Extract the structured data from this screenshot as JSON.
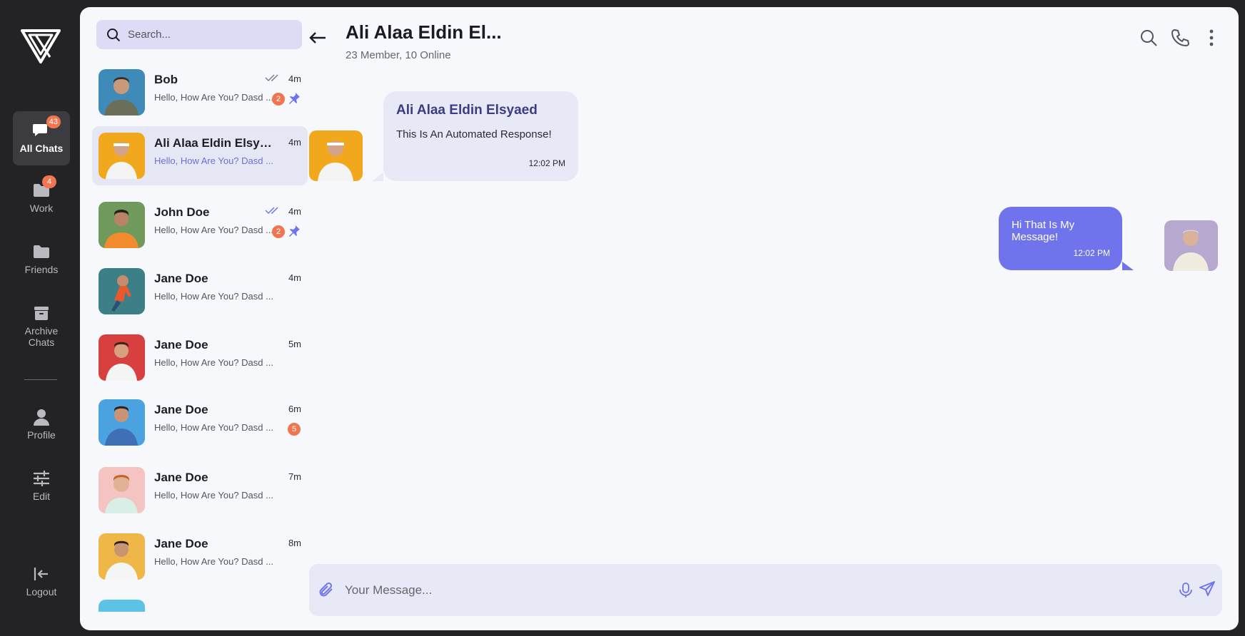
{
  "colors": {
    "accent": "#7074ec",
    "badge": "#f0764f",
    "rail_bg": "#232326",
    "panel_bg": "#f7f8fb"
  },
  "nav": {
    "items": [
      {
        "label": "All Chats",
        "icon": "chat-bubbles-icon",
        "badge": "43",
        "active": true
      },
      {
        "label": "Work",
        "icon": "folder-icon",
        "badge": "4"
      },
      {
        "label": "Friends",
        "icon": "folder-icon"
      },
      {
        "label": "Archive Chats",
        "icon": "archive-icon"
      },
      {
        "label": "Profile",
        "icon": "user-icon"
      },
      {
        "label": "Edit",
        "icon": "sliders-icon"
      },
      {
        "label": "Logout",
        "icon": "logout-icon"
      }
    ]
  },
  "search": {
    "placeholder": "Search..."
  },
  "chats": [
    {
      "name": "Bob",
      "time": "4m",
      "preview": "Hello, How Are You? Dasd ...",
      "unread": "2",
      "pinned": true,
      "read_ticks": true
    },
    {
      "name": "Ali Alaa Eldin Elsyaed",
      "time": "4m",
      "preview": "Hello, How Are You? Dasd ...",
      "selected": true
    },
    {
      "name": "John Doe",
      "time": "4m",
      "preview": "Hello, How Are You? Dasd ...",
      "unread": "2",
      "pinned": true,
      "read_ticks": true
    },
    {
      "name": "Jane Doe",
      "time": "4m",
      "preview": "Hello, How Are You? Dasd ..."
    },
    {
      "name": "Jane Doe",
      "time": "5m",
      "preview": "Hello, How Are You? Dasd ..."
    },
    {
      "name": "Jane Doe",
      "time": "6m",
      "preview": "Hello, How Are You? Dasd ...",
      "unread": "5"
    },
    {
      "name": "Jane Doe",
      "time": "7m",
      "preview": "Hello, How Are You? Dasd ..."
    },
    {
      "name": "Jane Doe",
      "time": "8m",
      "preview": "Hello, How Are You? Dasd ..."
    }
  ],
  "conversation": {
    "title": "Ali Alaa Eldin El...",
    "subtitle": "23 Member, 10 Online",
    "messages": [
      {
        "direction": "incoming",
        "sender": "Ali Alaa Eldin Elsyaed",
        "text": "This Is An Automated Response!",
        "time": "12:02 PM"
      },
      {
        "direction": "outgoing",
        "text": "Hi That Is My Message!",
        "time": "12:02 PM"
      }
    ]
  },
  "composer": {
    "placeholder": "Your Message..."
  }
}
